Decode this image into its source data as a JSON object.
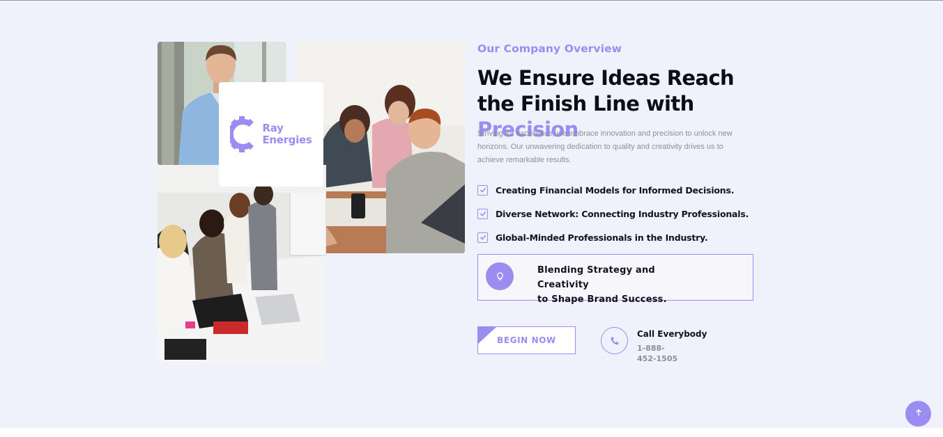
{
  "section": {
    "eyebrow": "Our Company Overview",
    "headline_main": "We Ensure Ideas Reach the Finish Line with ",
    "headline_accent": "Precision",
    "lead": "Striving for excellence, we embrace innovation and precision to unlock new horizons. Our unwavering dedication to quality and creativity drives us to achieve remarkable results.",
    "checklist": [
      "Creating Financial Models for Informed Decisions.",
      "Diverse Network: Connecting Industry Professionals.",
      "Global-Minded Professionals in the Industry."
    ],
    "feature": {
      "icon": "lightbulb-icon",
      "text_line1": "Blending Strategy and Creativity",
      "text_line2": "to Shape Brand Success."
    },
    "cta_label": "BEGIN NOW",
    "call": {
      "label": "Call Everybody",
      "number": "1-888-452-1505",
      "icon": "phone-icon"
    }
  },
  "logo": {
    "line1": "Ray",
    "line2": "Energies",
    "icon": "gear-icon"
  },
  "images": {
    "man": "portrait of smiling man in blue shirt",
    "meeting": "team discussing around laptops",
    "office": "colleagues working at office table"
  },
  "scroll_top": {
    "icon": "arrow-up-icon"
  },
  "colors": {
    "accent": "#9b8cf2",
    "background": "#eff2fa",
    "heading": "#0d0d1a",
    "muted": "#8c8f99"
  }
}
